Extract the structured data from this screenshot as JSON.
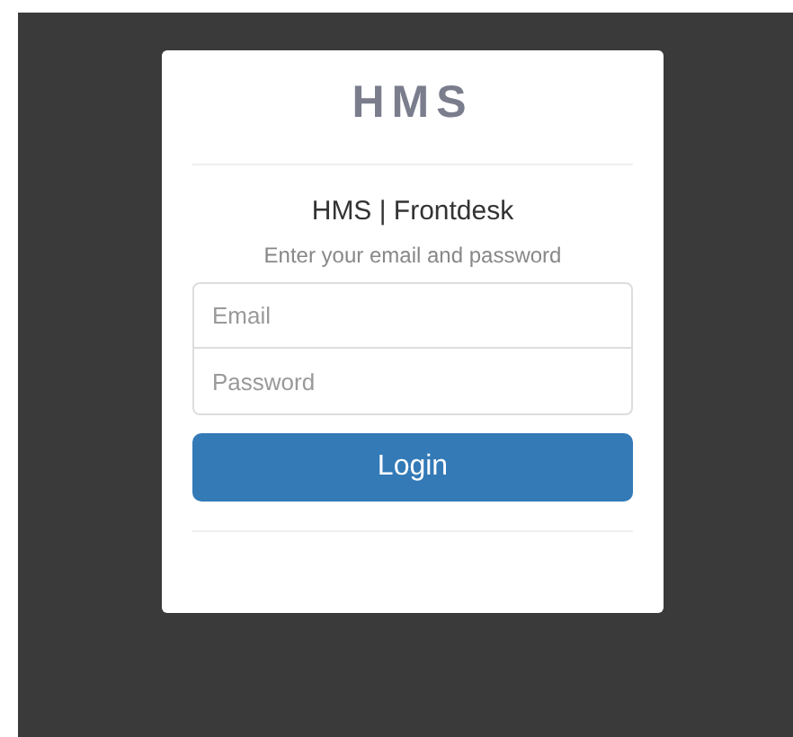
{
  "logo": "HMS",
  "title": "HMS | Frontdesk",
  "subtitle": "Enter your email and password",
  "fields": [
    {
      "placeholder": "Email"
    },
    {
      "placeholder": "Password"
    }
  ],
  "button": "Login"
}
